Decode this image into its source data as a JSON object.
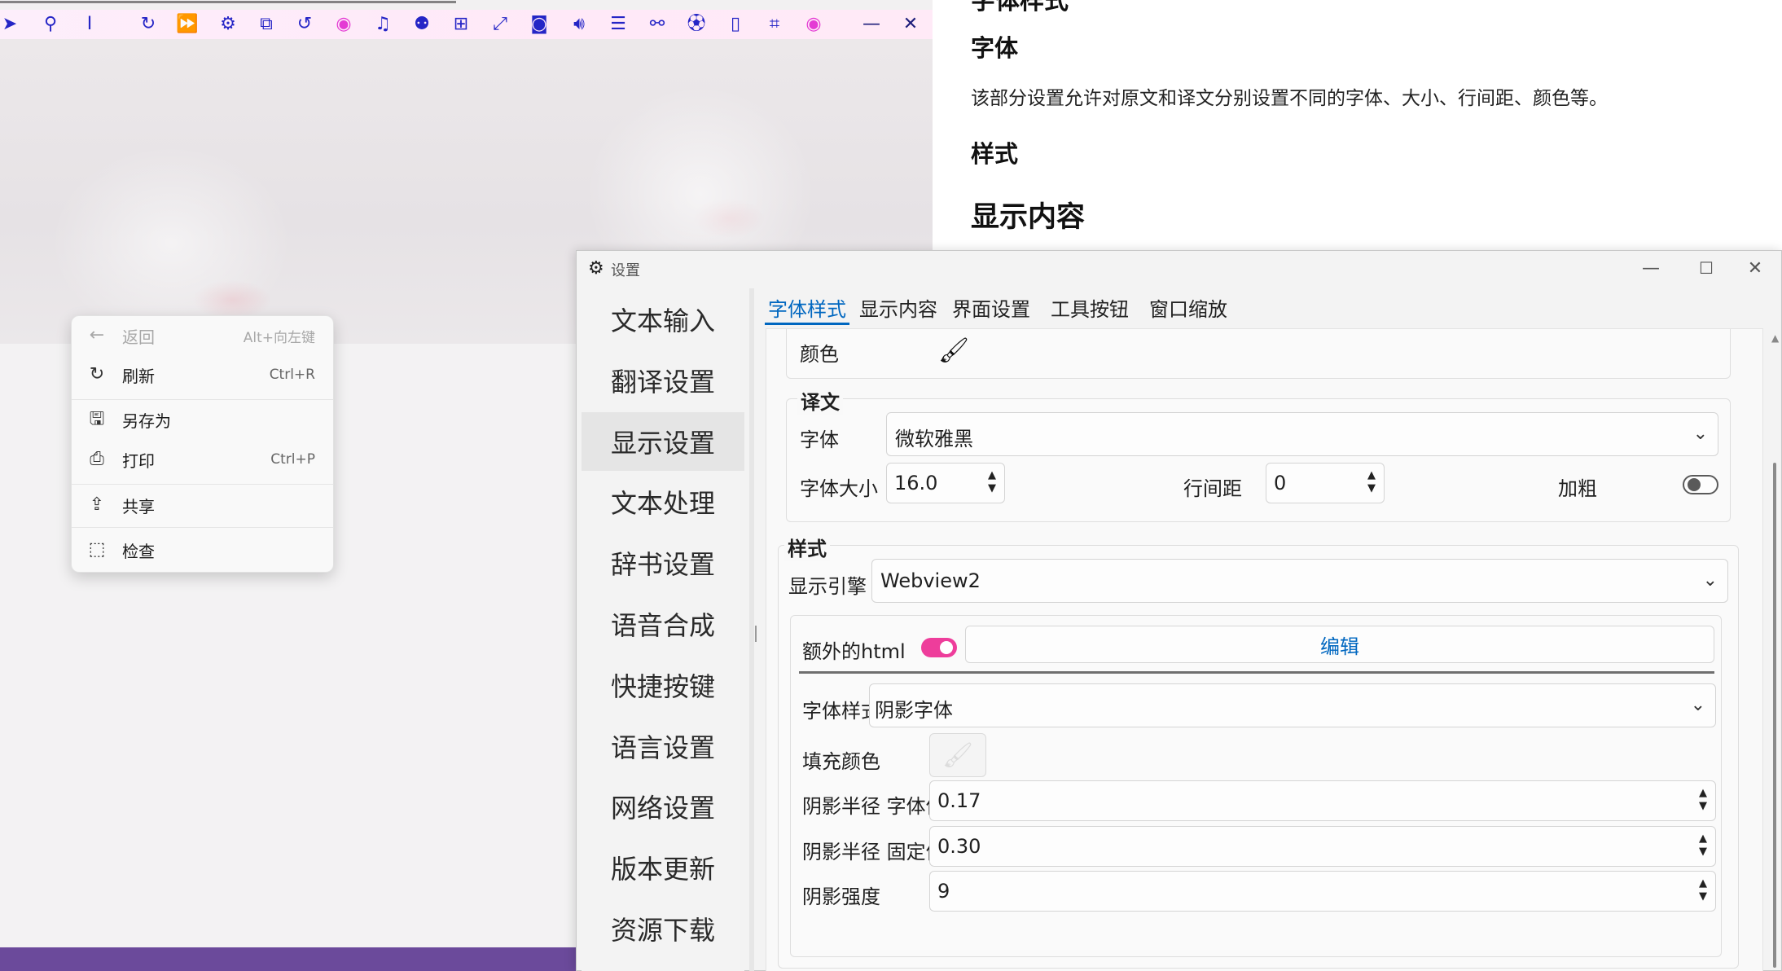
{
  "toolbar": {
    "icons": [
      {
        "name": "pointer-icon",
        "glyph": "➤",
        "color": "#2525c6"
      },
      {
        "name": "pin-icon",
        "glyph": "⚲",
        "color": "#2525c6"
      },
      {
        "name": "text-cursor-icon",
        "glyph": "I",
        "color": "#2525c6"
      },
      {
        "name": "refresh-icon",
        "glyph": "↻",
        "color": "#2525c6"
      },
      {
        "name": "fast-forward-icon",
        "glyph": "⏩",
        "color": "#e43bd4"
      },
      {
        "name": "settings-icon",
        "glyph": "⚙",
        "color": "#2525c6"
      },
      {
        "name": "copy-icon",
        "glyph": "⧉",
        "color": "#2525c6"
      },
      {
        "name": "undo-icon",
        "glyph": "↺",
        "color": "#2525c6"
      },
      {
        "name": "eye-icon",
        "glyph": "◉",
        "color": "#e43bd4"
      },
      {
        "name": "music-icon",
        "glyph": "♫",
        "color": "#2525c6"
      },
      {
        "name": "gamepad-icon",
        "glyph": "⚉",
        "color": "#2525c6"
      },
      {
        "name": "windows-icon",
        "glyph": "⊞",
        "color": "#2525c6"
      },
      {
        "name": "expand-icon",
        "glyph": "⤢",
        "color": "#2525c6"
      },
      {
        "name": "camera-icon",
        "glyph": "◙",
        "color": "#2525c6"
      },
      {
        "name": "volume-icon",
        "glyph": "🔊︎",
        "color": "#2525c6"
      },
      {
        "name": "list-icon",
        "glyph": "☰",
        "color": "#2525c6"
      },
      {
        "name": "sitemap-icon",
        "glyph": "⚯",
        "color": "#2525c6"
      },
      {
        "name": "soccer-ball-icon",
        "glyph": "⚽︎",
        "color": "#2525c6"
      },
      {
        "name": "file-icon",
        "glyph": "▯",
        "color": "#2525c6"
      },
      {
        "name": "crop-icon",
        "glyph": "⌗",
        "color": "#2525c6"
      },
      {
        "name": "eye-toggle-icon",
        "glyph": "◉",
        "color": "#e43bd4"
      },
      {
        "name": "minimize-icon",
        "glyph": "—",
        "color": "#1d1d7a"
      },
      {
        "name": "close-icon",
        "glyph": "✕",
        "color": "#1d1d7a"
      }
    ]
  },
  "context_menu": {
    "items": [
      {
        "icon": "back-arrow-icon",
        "glyph": "←",
        "label": "返回",
        "shortcut": "Alt+向左键",
        "disabled": true
      },
      {
        "icon": "refresh-icon",
        "glyph": "↻",
        "label": "刷新",
        "shortcut": "Ctrl+R",
        "disabled": false
      },
      {
        "icon": "save-as-icon",
        "glyph": "🖫︎",
        "label": "另存为",
        "shortcut": "",
        "disabled": false
      },
      {
        "icon": "print-icon",
        "glyph": "⎙",
        "label": "打印",
        "shortcut": "Ctrl+P",
        "disabled": false
      },
      {
        "icon": "share-icon",
        "glyph": "⇪",
        "label": "共享",
        "shortcut": "",
        "disabled": false
      },
      {
        "icon": "inspect-icon",
        "glyph": "⬚",
        "label": "检查",
        "shortcut": "",
        "disabled": false
      }
    ]
  },
  "doc": {
    "top_heading": "字体样式",
    "heading_font": "字体",
    "paragraph": "该部分设置允许对原文和译文分别设置不同的字体、大小、行间距、颜色等。",
    "heading_style": "样式",
    "heading_display": "显示内容"
  },
  "dialog": {
    "title": "设置",
    "nav": [
      "文本输入",
      "翻译设置",
      "显示设置",
      "文本处理",
      "辞书设置",
      "语音合成",
      "快捷按键",
      "语言设置",
      "网络设置",
      "版本更新",
      "资源下载"
    ],
    "nav_active": 2,
    "tabs": [
      "字体样式",
      "显示内容",
      "界面设置",
      "工具按钮",
      "窗口缩放"
    ],
    "tab_active": 0,
    "accent": "#0067c0",
    "toggle_on_color": "#ee3d9b",
    "original": {
      "color_label": "颜色"
    },
    "translation": {
      "group_label": "译文",
      "font_label": "字体",
      "font_value": "微软雅黑",
      "size_label": "字体大小",
      "size_value": "16.0",
      "spacing_label": "行间距",
      "spacing_value": "0",
      "bold_label": "加粗",
      "bold_on": false
    },
    "style": {
      "group_label": "样式",
      "engine_label": "显示引擎",
      "engine_value": "Webview2",
      "extra_html_label": "额外的html",
      "extra_html_on": true,
      "edit_button": "编辑",
      "font_style_label": "字体样式",
      "font_style_value": "阴影字体",
      "fill_color_label": "填充颜色",
      "shadow_radius_ratio_label": "阴影半径 字体倍率",
      "shadow_radius_ratio_value": "0.17",
      "shadow_radius_fixed_label": "阴影半径 固定值",
      "shadow_radius_fixed_value": "0.30",
      "shadow_strength_label": "阴影强度",
      "shadow_strength_value": "9"
    }
  }
}
